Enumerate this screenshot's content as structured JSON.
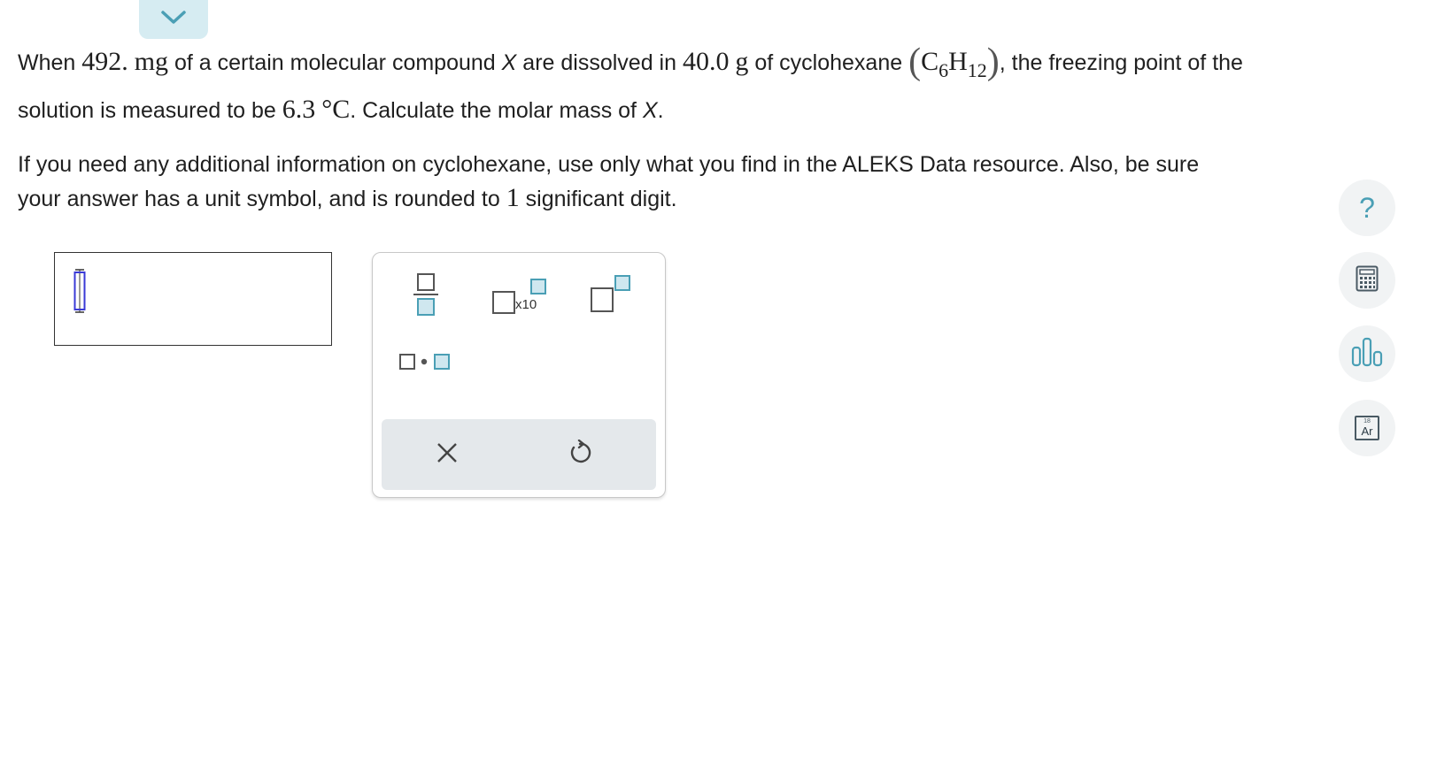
{
  "question": {
    "line1": {
      "t1": "When ",
      "mass": "492.",
      "t2": " ",
      "mass_unit": "mg",
      "t3": " of a certain molecular compound ",
      "var": "X",
      "t4": " are dissolved in ",
      "solvent_mass": "40.0",
      "t5": " ",
      "solvent_unit": "g",
      "t6": " of cyclohexane ",
      "f_open": "(",
      "f_c": "C",
      "f_c_sub": "6",
      "f_h": "H",
      "f_h_sub": "12",
      "f_close": ")",
      "t7": ", the freezing point of the"
    },
    "line2": {
      "t1": "solution is measured to be ",
      "fp": "6.3",
      "t2": " ",
      "fp_unit": "°C",
      "t3": ". Calculate the molar mass of ",
      "var": "X",
      "t4": "."
    },
    "line3": "If you need any additional information on cyclohexane, use only what you find in the ALEKS Data resource. Also, be sure",
    "line4": {
      "t1": "your answer has a unit symbol, and is rounded to ",
      "digits": "1",
      "t2": " significant digit."
    }
  },
  "palette": {
    "x10_label": "x10"
  },
  "sidebar": {
    "help_label": "?",
    "periodic_number": "18",
    "periodic_symbol": "Ar"
  },
  "colors": {
    "accent": "#4a9fb5",
    "tab_bg": "#d6ecf2",
    "cursor_blue": "#3a3ad6"
  },
  "icons": [
    "chevron-down-icon",
    "help-icon",
    "calculator-icon",
    "bar-chart-icon",
    "periodic-table-icon",
    "fraction-icon",
    "scientific-notation-icon",
    "superscript-icon",
    "multiply-dot-icon",
    "clear-icon",
    "undo-icon"
  ]
}
